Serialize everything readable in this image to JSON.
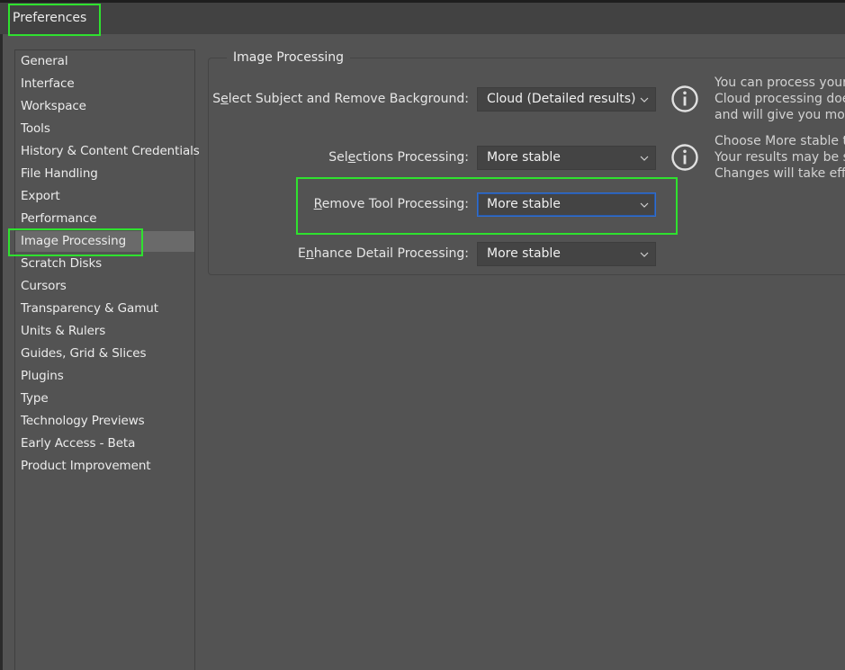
{
  "window": {
    "title": "Preferences"
  },
  "sidebar": {
    "items": [
      {
        "label": "General"
      },
      {
        "label": "Interface"
      },
      {
        "label": "Workspace"
      },
      {
        "label": "Tools"
      },
      {
        "label": "History & Content Credentials"
      },
      {
        "label": "File Handling"
      },
      {
        "label": "Export"
      },
      {
        "label": "Performance"
      },
      {
        "label": "Image Processing"
      },
      {
        "label": "Scratch Disks"
      },
      {
        "label": "Cursors"
      },
      {
        "label": "Transparency & Gamut"
      },
      {
        "label": "Units & Rulers"
      },
      {
        "label": "Guides, Grid & Slices"
      },
      {
        "label": "Plugins"
      },
      {
        "label": "Type"
      },
      {
        "label": "Technology Previews"
      },
      {
        "label": "Early Access - Beta"
      },
      {
        "label": "Product Improvement"
      }
    ],
    "selected": "Image Processing"
  },
  "panel": {
    "group_title": "Image Processing",
    "rows": {
      "select_subject": {
        "label_pre": "S",
        "label_u": "e",
        "label_post": "lect Subject and Remove Background:",
        "value": "Cloud (Detailed results)"
      },
      "selections": {
        "label_pre": "Sel",
        "label_u": "e",
        "label_post": "ctions Processing:",
        "value": "More stable"
      },
      "remove_tool": {
        "label_pre": "",
        "label_u": "R",
        "label_post": "emove Tool Processing:",
        "value": "More stable"
      },
      "enhance_detail": {
        "label_pre": "E",
        "label_u": "n",
        "label_post": "hance Detail Processing:",
        "value": "More stable"
      }
    },
    "info_1": {
      "lines": [
        "You can process your",
        "Cloud processing doe",
        "and will give you more"
      ]
    },
    "info_2": {
      "lines": [
        "Choose More stable t",
        "Your results may be s",
        "Changes will take effe"
      ]
    }
  },
  "colors": {
    "highlight": "#2fe12f",
    "focus": "#2f6ed1",
    "background": "#535353",
    "selected_item": "#6a6a6a"
  },
  "icons": {
    "info": "info-circle-icon",
    "dropdown": "chevron-down-icon"
  }
}
